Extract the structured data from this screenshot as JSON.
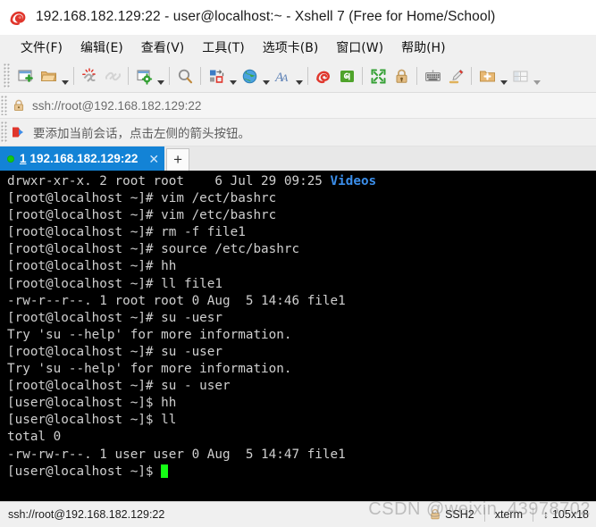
{
  "window": {
    "title": "192.168.182.129:22 - user@localhost:~ - Xshell 7 (Free for Home/School)",
    "logo_icon": "xshell-spiral-logo"
  },
  "menubar": {
    "items": [
      {
        "label": "文件(F)",
        "name": "menu-file"
      },
      {
        "label": "编辑(E)",
        "name": "menu-edit"
      },
      {
        "label": "查看(V)",
        "name": "menu-view"
      },
      {
        "label": "工具(T)",
        "name": "menu-tools"
      },
      {
        "label": "选项卡(B)",
        "name": "menu-tabs"
      },
      {
        "label": "窗口(W)",
        "name": "menu-window"
      },
      {
        "label": "帮助(H)",
        "name": "menu-help"
      }
    ]
  },
  "toolbar": {
    "buttons": [
      {
        "name": "new-session-icon",
        "title": "新建会话"
      },
      {
        "name": "open-session-folder-icon",
        "title": "打开"
      },
      {
        "name": "disconnect-icon",
        "title": "断开"
      },
      {
        "name": "reconnect-icon",
        "title": "重新连接"
      },
      {
        "name": "session-properties-icon",
        "title": "属性"
      },
      {
        "name": "find-icon",
        "title": "查找"
      },
      {
        "name": "file-transfer-icon",
        "title": "传输文件"
      },
      {
        "name": "globe-icon",
        "title": "编码"
      },
      {
        "name": "font-icon",
        "title": "字体"
      },
      {
        "name": "xshell-icon",
        "title": "Xshell"
      },
      {
        "name": "xftp-icon",
        "title": "Xftp"
      },
      {
        "name": "fullscreen-icon",
        "title": "全屏"
      },
      {
        "name": "lock-icon",
        "title": "锁定"
      },
      {
        "name": "keyboard-icon",
        "title": "发送键输入"
      },
      {
        "name": "highlighter-icon",
        "title": "高亮"
      },
      {
        "name": "add-folder-icon",
        "title": "新建文件夹"
      },
      {
        "name": "layout-icon",
        "title": "布局"
      }
    ]
  },
  "address": {
    "lock_icon": "lock-icon",
    "url": "ssh://root@192.168.182.129:22"
  },
  "notice": {
    "icon": "red-arrow-icon",
    "text": "要添加当前会话，点击左侧的箭头按钮。"
  },
  "tabs": {
    "active": {
      "status_dot": "connected-dot",
      "number": "1",
      "label": "192.168.182.129:22",
      "close_label": "✕"
    },
    "new_tab_label": "+"
  },
  "terminal": {
    "lines": [
      {
        "text": "drwxr-xr-x. 2 root root    6 Jul 29 09:25 ",
        "dir": "Videos"
      },
      {
        "text": "[root@localhost ~]# vim /ect/bashrc"
      },
      {
        "text": "[root@localhost ~]# vim /etc/bashrc"
      },
      {
        "text": "[root@localhost ~]# rm -f file1"
      },
      {
        "text": "[root@localhost ~]# source /etc/bashrc"
      },
      {
        "text": "[root@localhost ~]# hh"
      },
      {
        "text": "[root@localhost ~]# ll file1"
      },
      {
        "text": "-rw-r--r--. 1 root root 0 Aug  5 14:46 file1"
      },
      {
        "text": "[root@localhost ~]# su -uesr"
      },
      {
        "text": "Try 'su --help' for more information."
      },
      {
        "text": "[root@localhost ~]# su -user"
      },
      {
        "text": "Try 'su --help' for more information."
      },
      {
        "text": "[root@localhost ~]# su - user"
      },
      {
        "text": "[user@localhost ~]$ hh"
      },
      {
        "text": "[user@localhost ~]$ ll"
      },
      {
        "text": "total 0"
      },
      {
        "text": "-rw-rw-r--. 1 user user 0 Aug  5 14:47 file1"
      },
      {
        "text": "[user@localhost ~]$ ",
        "cursor": true
      }
    ]
  },
  "statusbar": {
    "connection": "ssh://root@192.168.182.129:22",
    "ssh_icon": "ssh-lock-icon",
    "protocol": "SSH2",
    "terminal_type": "xterm",
    "resize_icon": "↕",
    "size": "105x18"
  },
  "watermark": {
    "text": "CSDN @weixin_43978702"
  },
  "colors": {
    "accent": "#1383d6",
    "terminal_bg": "#000000",
    "terminal_fg": "#cfcfcf",
    "dir_blue": "#3b8eea",
    "cursor_green": "#15ff15",
    "chrome_bg": "#f0f0f0"
  }
}
